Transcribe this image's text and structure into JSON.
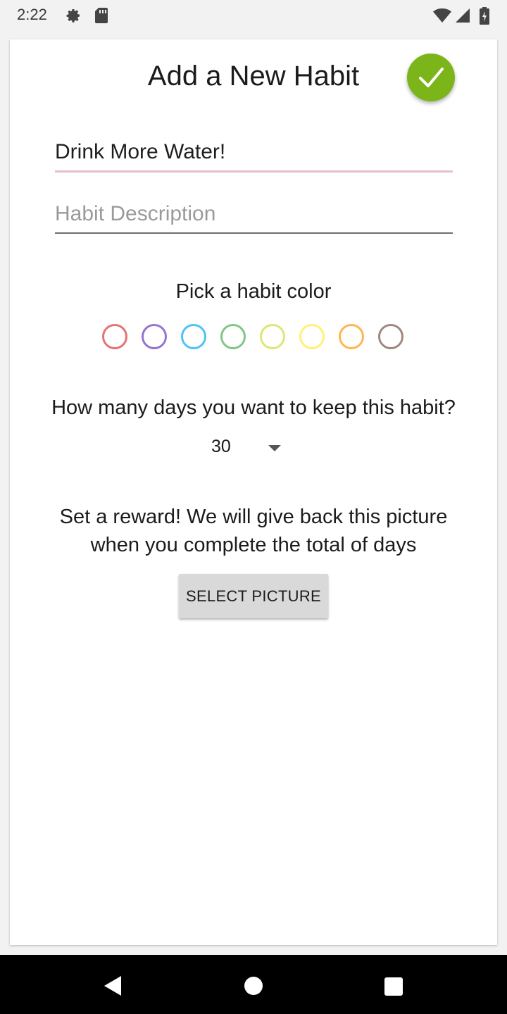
{
  "status_bar": {
    "time": "2:22",
    "icons": [
      "gear-icon",
      "sd-card-icon",
      "wifi-icon",
      "signal-icon",
      "battery-icon"
    ]
  },
  "header": {
    "title": "Add a New Habit",
    "confirm_icon": "check-icon",
    "confirm_color": "#7cb519"
  },
  "form": {
    "name_value": "Drink More Water!",
    "name_placeholder": "",
    "description_value": "",
    "description_placeholder": "Habit Description"
  },
  "color_picker": {
    "label": "Pick a habit color",
    "colors": [
      "#e57373",
      "#9575cd",
      "#4fc3f7",
      "#81c784",
      "#dce775",
      "#fff176",
      "#ffb74d",
      "#a1887f"
    ]
  },
  "days": {
    "label": "How many days you want to keep this habit?",
    "selected": "30",
    "dropdown_icon": "dropdown-arrow-icon"
  },
  "reward": {
    "text_line1": "Set a reward! We will give back this picture",
    "text_line2": "when you complete the total of days",
    "button_label": "SELECT PICTURE"
  },
  "nav": {
    "icons": [
      "back-icon",
      "home-icon",
      "recents-icon"
    ]
  }
}
